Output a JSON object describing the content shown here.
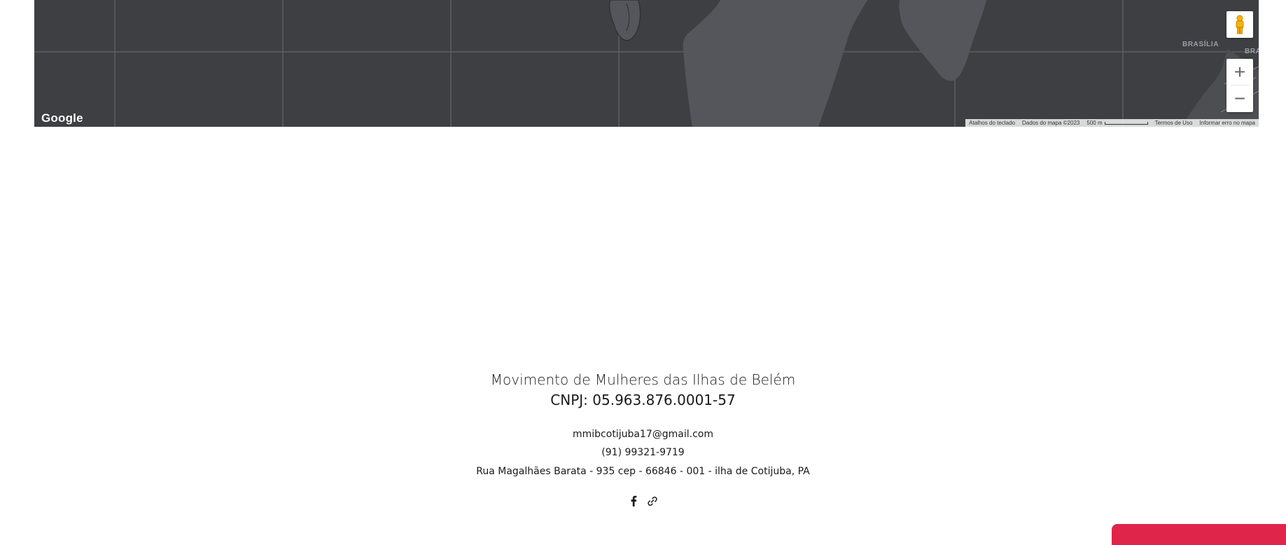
{
  "map": {
    "provider_logo": "Google",
    "city_label": "BRASÍLIA",
    "city_label_partial": "BRA",
    "attribution": {
      "keyboard_shortcuts": "Atalhos do teclado",
      "map_data": "Dados do mapa ©2023",
      "scale": "500 m",
      "terms": "Termos de Uso",
      "report": "Informar erro no mapa"
    },
    "controls": {
      "zoom_in": "+",
      "zoom_out": "−"
    },
    "icons": [
      "pegman-icon",
      "zoom-in-icon",
      "zoom-out-icon"
    ]
  },
  "footer": {
    "org_name": "Movimento de Mulheres das Ilhas de Belém",
    "cnpj": "CNPJ:  05.963.876.0001-57",
    "email": "mmibcotijuba17@gmail.com",
    "phone": "(91) 99321-9719",
    "address": "Rua Magalhães Barata - 935 cep - 66846 - 001 - ilha de Cotijuba, PA",
    "social": [
      "facebook-icon",
      "link-icon"
    ]
  },
  "colors": {
    "map_background": "#3e3f43",
    "land": "#55565b",
    "accent_tab": "#e0254a",
    "text": "#1a1a1a"
  }
}
